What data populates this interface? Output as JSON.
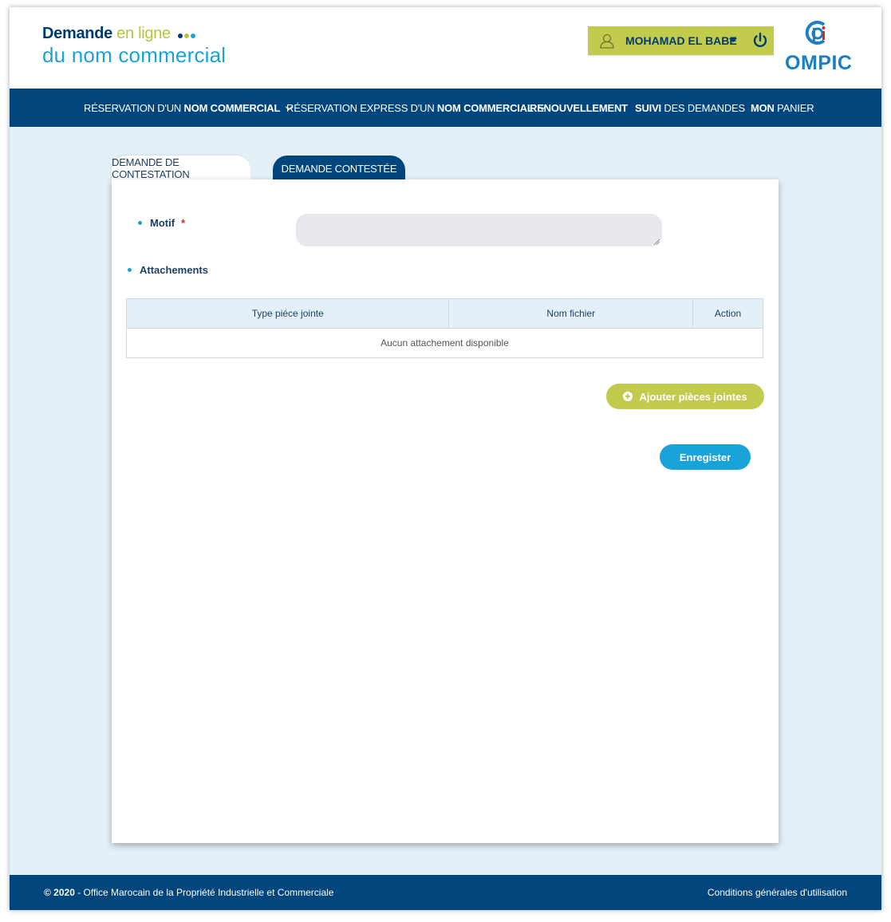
{
  "brand": {
    "line1_main": "Demande",
    "line1_accent": "en ligne",
    "line2": "du nom commercial",
    "dot_colors": [
      "#003b6f",
      "#b8c436",
      "#1aa3d9"
    ]
  },
  "user": {
    "name": "MOHAMAD EL BABE",
    "icon": "user-icon",
    "logout_icon": "power-icon"
  },
  "logo": {
    "text": "OMPIC"
  },
  "nav": {
    "items": [
      {
        "prefix": "RÉSERVATION D'UN ",
        "bold": "NOM COMMERCIAL",
        "suffix": "",
        "dropdown": true
      },
      {
        "prefix": "RÉSERVATION EXPRESS D'UN ",
        "bold": "NOM COMMERCIAL",
        "suffix": "",
        "dropdown": true
      },
      {
        "prefix": "",
        "bold": "RENOUVELLEMENT",
        "suffix": "",
        "dropdown": false
      },
      {
        "prefix": "",
        "bold": "SUIVI",
        "suffix": " DES DEMANDES",
        "dropdown": false
      },
      {
        "prefix": "",
        "bold": "MON",
        "suffix": " PANIER",
        "dropdown": false
      }
    ]
  },
  "tabs": {
    "active": "DEMANDE DE CONTESTATION",
    "inactive": "DEMANDE CONTESTÉE"
  },
  "form": {
    "motif_label": "Motif",
    "required_mark": "*",
    "motif_value": "",
    "attachments_label": "Attachements",
    "table": {
      "headers": [
        "Type piéce jointe",
        "Nom fichier",
        "Action"
      ],
      "empty_message": "Aucun attachement disponible"
    },
    "add_button": "Ajouter pièces jointes",
    "save_button": "Enregister"
  },
  "footer": {
    "year": "© 2020",
    "org": " - Office Marocain de la Propriété Industrielle et Commerciale",
    "terms": "Conditions générales d'utilisation"
  }
}
